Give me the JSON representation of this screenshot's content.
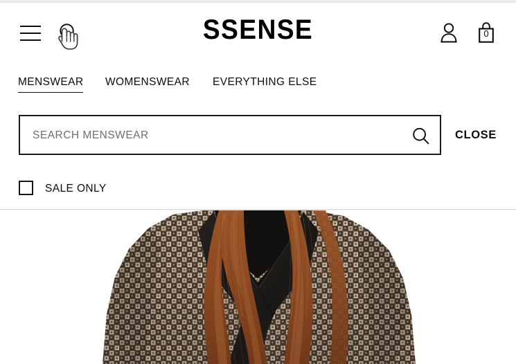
{
  "brand": {
    "logo_text": "SSENSE"
  },
  "header": {
    "menu_icon": "hamburger-menu-icon",
    "search_icon": "search-icon",
    "cursor_icon": "pointing-hand-cursor",
    "account_icon": "account-person-icon",
    "bag_icon": "shopping-bag-icon",
    "bag_count": "0"
  },
  "nav": {
    "tabs": [
      {
        "label": "MENSWEAR",
        "active": true
      },
      {
        "label": "WOMENSWEAR",
        "active": false
      },
      {
        "label": "EVERYTHING ELSE",
        "active": false
      }
    ]
  },
  "search": {
    "placeholder": "SEARCH MENSWEAR",
    "value": "",
    "submit_icon": "search-magnifier-icon",
    "close_label": "CLOSE"
  },
  "filters": {
    "sale_only_label": "SALE ONLY",
    "sale_only_checked": false
  },
  "product": {
    "description": "Model wearing brown and cream checkered patterned blazer with black shawl lapel over black top, auburn wavy hair",
    "colors": {
      "jacket_dark": "#4a3a30",
      "jacket_mid": "#6b5748",
      "jacket_light": "#cbbfae",
      "jacket_cream": "#e3dcd0",
      "lapel_black": "#1d1b1a",
      "top_black": "#121110",
      "hair": "#8a4a22",
      "hair_light": "#b06a34",
      "background": "#ffffff"
    }
  },
  "theme": {
    "text_color": "#0b0b0b",
    "placeholder_color": "#6e6e6e",
    "border_color": "#1a1a1a",
    "divider_color": "#d8d8d8",
    "page_background": "#ffffff"
  }
}
